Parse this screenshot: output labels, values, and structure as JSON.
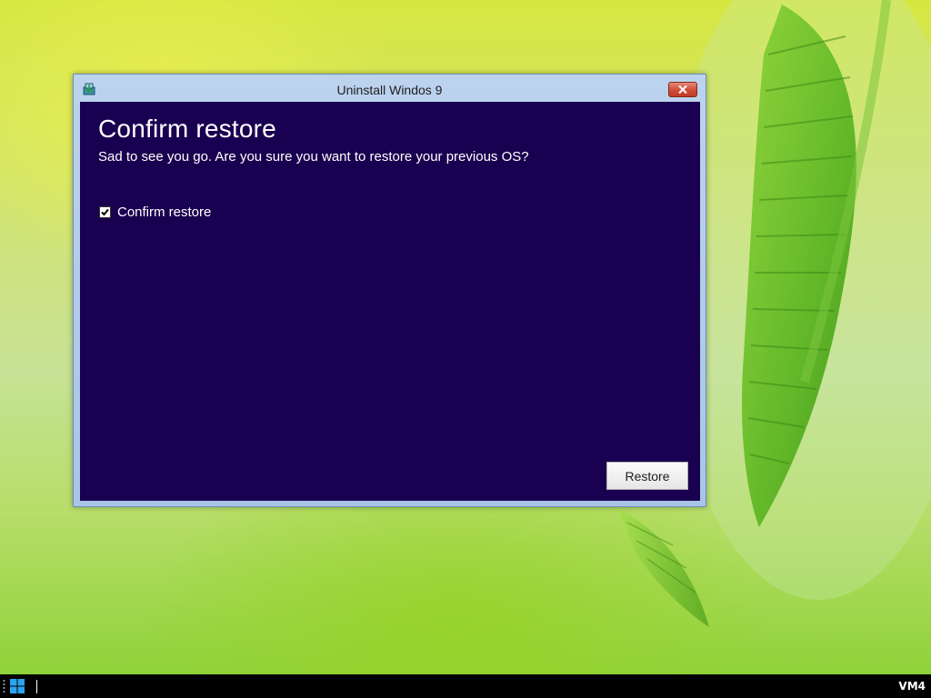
{
  "window": {
    "title": "Uninstall Windos 9",
    "icon": "app-installer-icon",
    "close_icon": "close-x-icon"
  },
  "dialog": {
    "heading": "Confirm restore",
    "subheading": "Sad to see you go. Are you sure you want to restore your previous OS?",
    "checkbox_label": "Confirm restore",
    "checkbox_checked": true,
    "restore_button_label": "Restore",
    "background_color": "#1a0050"
  },
  "taskbar": {
    "start_icon": "windows-logo-icon",
    "machine_label": "VM4"
  },
  "colors": {
    "close_button": "#c94a36",
    "window_frame": "#a9c4e6",
    "taskbar": "#000000"
  }
}
